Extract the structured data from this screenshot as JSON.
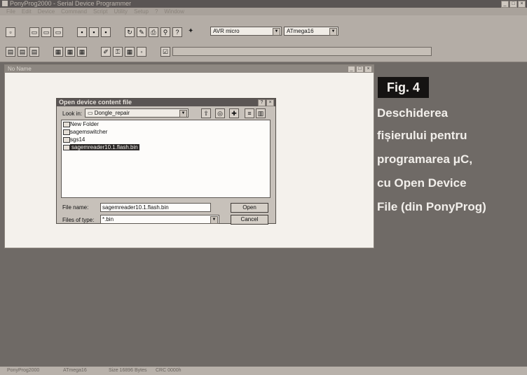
{
  "app_window": {
    "title": "PonyProg2000 - Serial Device Programmer",
    "controls": [
      "_",
      "□",
      "×"
    ]
  },
  "menu": [
    "File",
    "Edit",
    "Device",
    "Command",
    "Script",
    "Utility",
    "Setup",
    "?",
    "Window"
  ],
  "toolbar": {
    "device_family": "AVR micro",
    "device_type": "ATmega16"
  },
  "document_window": {
    "title": "No Name",
    "controls": [
      "_",
      "□",
      "×"
    ]
  },
  "dialog": {
    "title": "Open device content file",
    "title_buttons": [
      "?",
      "×"
    ],
    "look_in_label": "Look in:",
    "look_in_value": "Dongle_repair",
    "files": [
      {
        "name": "New Folder",
        "type": "folder",
        "selected": false
      },
      {
        "name": "sagemswitcher",
        "type": "folder",
        "selected": false
      },
      {
        "name": "sgs14",
        "type": "folder",
        "selected": false
      },
      {
        "name": "sagemreader10.1.flash.bin",
        "type": "file",
        "selected": true
      }
    ],
    "file_name_label": "File name:",
    "file_name_value": "sagemreader10.1.flash.bin",
    "files_of_type_label": "Files of type:",
    "files_of_type_value": "*.bin",
    "open_label": "Open",
    "cancel_label": "Cancel"
  },
  "caption": {
    "fig": "Fig. 4",
    "lines": [
      "Deschiderea",
      "fișierului pentru",
      "programarea μC,",
      "cu Open Device",
      "File (din PonyProg)"
    ]
  },
  "status_bar": {
    "app": "PonyProg2000",
    "device": "ATmega16",
    "size": "Size 16896 Bytes",
    "crc": "CRC 0000h"
  },
  "colors": {
    "background": "#6f6a66",
    "toolbar": "#b4ada6",
    "selection": "#2b2827",
    "caption_text": "#f2efeb"
  }
}
